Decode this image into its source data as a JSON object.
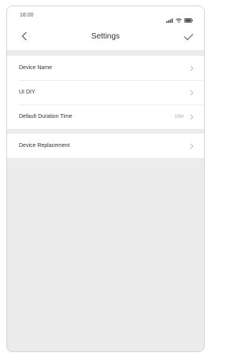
{
  "status_bar": {
    "time": "18:00",
    "icons": [
      "signal-icon",
      "wifi-icon",
      "battery-icon"
    ]
  },
  "nav": {
    "title": "Settings",
    "back_icon": "chevron-left-icon",
    "confirm_icon": "checkmark-icon"
  },
  "settings": {
    "items": [
      {
        "label": "Device Name",
        "value": ""
      },
      {
        "label": "UI DIY",
        "value": ""
      },
      {
        "label": "Default Duration Time",
        "value": "10M"
      }
    ],
    "replacement": {
      "label": "Device Replacement"
    }
  },
  "colors": {
    "background": "#ececec",
    "card": "#ffffff",
    "text": "#333333",
    "muted": "#aaaaaa"
  }
}
